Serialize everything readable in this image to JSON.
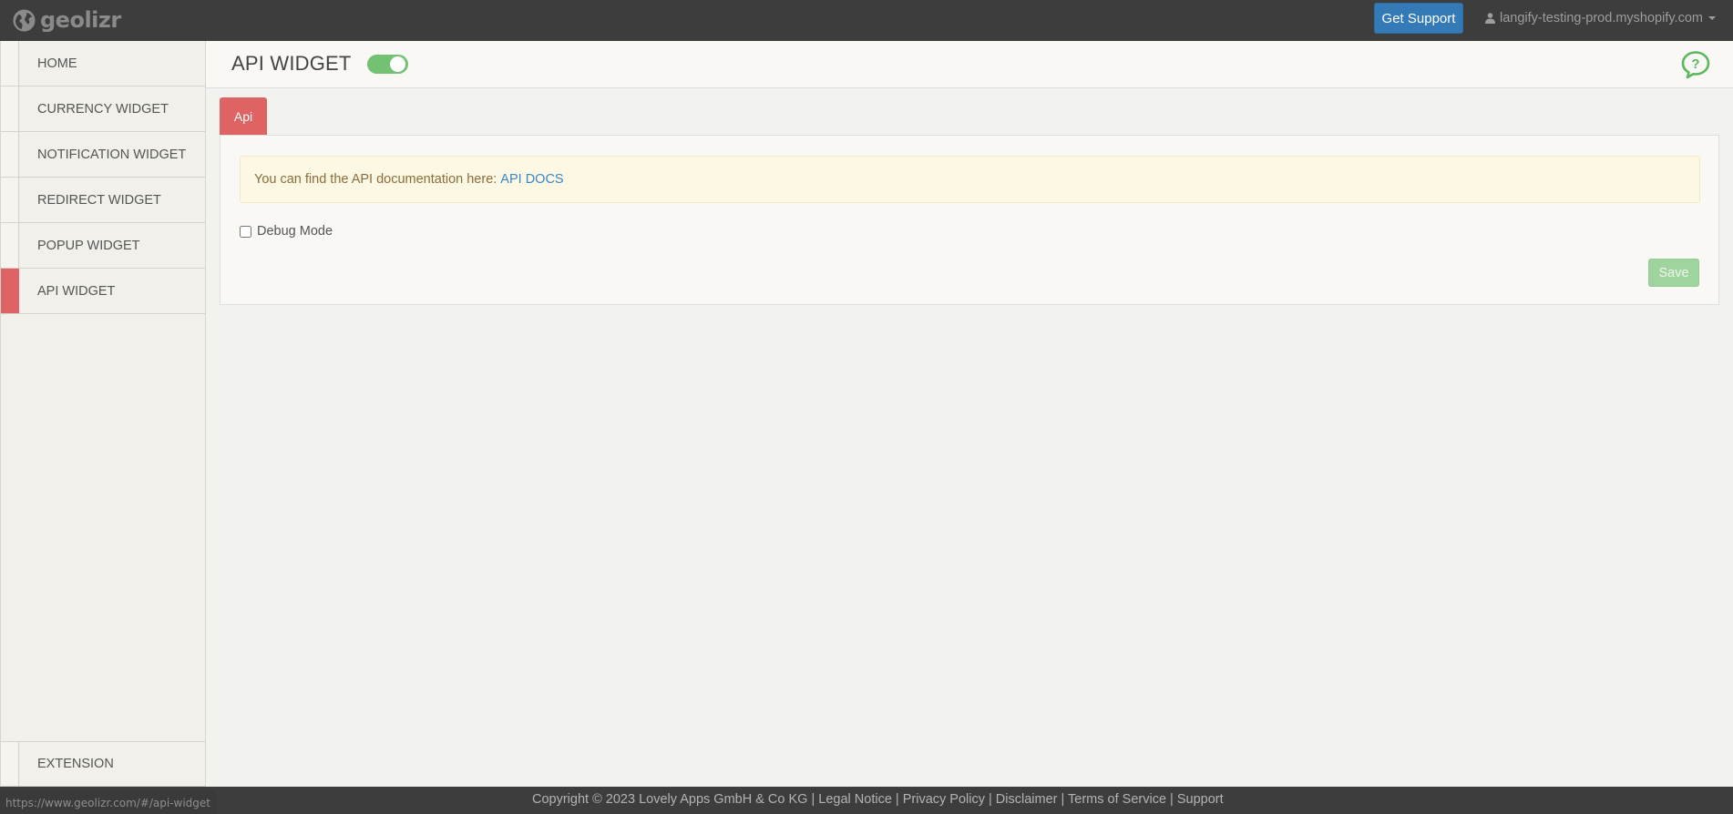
{
  "topbar": {
    "brand": "geolizr",
    "support_label": "Get Support",
    "user_label": "langify-testing-prod.myshopify.com"
  },
  "sidebar": {
    "items": [
      {
        "label": "HOME",
        "active": false
      },
      {
        "label": "CURRENCY WIDGET",
        "active": false
      },
      {
        "label": "NOTIFICATION WIDGET",
        "active": false
      },
      {
        "label": "REDIRECT WIDGET",
        "active": false
      },
      {
        "label": "POPUP WIDGET",
        "active": false
      },
      {
        "label": "API WIDGET",
        "active": true
      }
    ],
    "extension_label": "EXTENSION"
  },
  "header": {
    "title": "API WIDGET",
    "toggle_on": true
  },
  "tabs": [
    {
      "label": "Api",
      "active": true
    }
  ],
  "panel": {
    "alert_text": "You can find the API documentation here:",
    "alert_link": "API DOCS",
    "debug_label": "Debug Mode",
    "debug_checked": false,
    "save_label": "Save"
  },
  "footer": {
    "copyright": "Copyright © 2023 Lovely Apps GmbH & Co KG",
    "separator": " | ",
    "links": [
      "Legal Notice",
      "Privacy Policy",
      "Disclaimer",
      "Terms of Service",
      "Support"
    ]
  },
  "status_url": "https://www.geolizr.com/#/api-widget",
  "colors": {
    "topbar": "#3d3d3d",
    "accent_red": "#e06363",
    "support_blue": "#337ab7",
    "toggle_green": "#5cb85c",
    "alert_bg": "#fcf8e3",
    "link_blue": "#3a87c5"
  },
  "icons": {
    "brand": "globe-icon",
    "user": "user-icon",
    "help": "help-chat-icon"
  }
}
